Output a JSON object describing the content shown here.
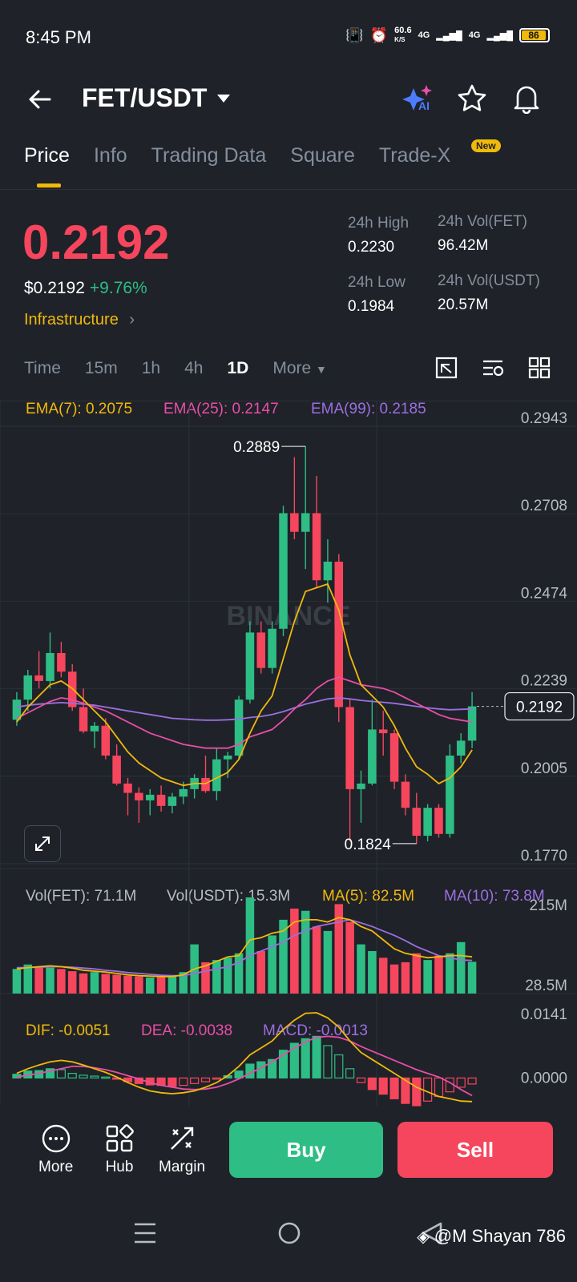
{
  "status_bar": {
    "time": "8:45 PM",
    "net_speed": "60.6",
    "net_unit": "K/S",
    "signal1": "4G",
    "signal2": "4G",
    "battery": "86"
  },
  "header": {
    "pair": "FET/USDT",
    "ai_label": "AI"
  },
  "tabs": [
    {
      "label": "Price",
      "active": true
    },
    {
      "label": "Info"
    },
    {
      "label": "Trading Data"
    },
    {
      "label": "Square"
    },
    {
      "label": "Trade-X",
      "badge": "New"
    }
  ],
  "ticker": {
    "last_price": "0.2192",
    "usd_price": "$0.2192",
    "change_pct": "+9.76%",
    "category": "Infrastructure",
    "high_label": "24h High",
    "high": "0.2230",
    "low_label": "24h Low",
    "low": "0.1984",
    "vol_base_label": "24h Vol(FET)",
    "vol_base": "96.42M",
    "vol_quote_label": "24h Vol(USDT)",
    "vol_quote": "20.57M"
  },
  "intervals": [
    {
      "label": "Time"
    },
    {
      "label": "15m"
    },
    {
      "label": "1h"
    },
    {
      "label": "4h"
    },
    {
      "label": "1D",
      "active": true
    },
    {
      "label": "More"
    }
  ],
  "indicators": {
    "ema7": "EMA(7): 0.2075",
    "ema25": "EMA(25): 0.2147",
    "ema99": "EMA(99): 0.2185",
    "vol_base": "Vol(FET): 71.1M",
    "vol_quote": "Vol(USDT): 15.3M",
    "ma5": "MA(5): 82.5M",
    "ma10": "MA(10): 73.8M",
    "dif": "DIF: -0.0051",
    "dea": "DEA: -0.0038",
    "macd": "MACD: -0.0013"
  },
  "colors": {
    "up": "#2ebd85",
    "down": "#f6465d",
    "ema7": "#f0b90b",
    "ema25": "#e84ea7",
    "ema99": "#9b6fe0",
    "accent": "#f0b90b"
  },
  "chart_data": {
    "type": "candlestick",
    "price_axis": [
      "0.2943",
      "0.2708",
      "0.2474",
      "0.2239",
      "0.2005",
      "0.1770"
    ],
    "current_price_tag": "0.2192",
    "high_marker": "0.2889",
    "low_marker": "0.1824",
    "watermark": "BINANCE",
    "volume_axis": [
      "215M",
      "28.5M"
    ],
    "macd_axis": [
      "0.0141",
      "0.0000"
    ],
    "ylim": [
      0.177,
      0.2943
    ],
    "candles": [
      [
        0.2156,
        0.223,
        0.214,
        0.221
      ],
      [
        0.221,
        0.229,
        0.218,
        0.2275
      ],
      [
        0.2275,
        0.234,
        0.224,
        0.226
      ],
      [
        0.226,
        0.239,
        0.224,
        0.2335
      ],
      [
        0.2335,
        0.2365,
        0.227,
        0.2285
      ],
      [
        0.2285,
        0.2305,
        0.218,
        0.219
      ],
      [
        0.219,
        0.224,
        0.212,
        0.2125
      ],
      [
        0.2125,
        0.215,
        0.208,
        0.214
      ],
      [
        0.214,
        0.216,
        0.205,
        0.206
      ],
      [
        0.206,
        0.209,
        0.198,
        0.1985
      ],
      [
        0.1985,
        0.2,
        0.19,
        0.196
      ],
      [
        0.196,
        0.1975,
        0.188,
        0.194
      ],
      [
        0.194,
        0.197,
        0.19,
        0.1955
      ],
      [
        0.1955,
        0.198,
        0.191,
        0.1925
      ],
      [
        0.1925,
        0.196,
        0.1905,
        0.195
      ],
      [
        0.195,
        0.199,
        0.193,
        0.197
      ],
      [
        0.197,
        0.201,
        0.1945,
        0.2
      ],
      [
        0.2,
        0.206,
        0.196,
        0.1965
      ],
      [
        0.1965,
        0.208,
        0.194,
        0.205
      ],
      [
        0.205,
        0.207,
        0.2,
        0.206
      ],
      [
        0.206,
        0.222,
        0.205,
        0.221
      ],
      [
        0.221,
        0.242,
        0.22,
        0.239
      ],
      [
        0.239,
        0.242,
        0.228,
        0.2295
      ],
      [
        0.2295,
        0.242,
        0.228,
        0.24
      ],
      [
        0.24,
        0.273,
        0.238,
        0.271
      ],
      [
        0.271,
        0.286,
        0.264,
        0.266
      ],
      [
        0.266,
        0.2889,
        0.256,
        0.271
      ],
      [
        0.271,
        0.281,
        0.251,
        0.253
      ],
      [
        0.253,
        0.264,
        0.247,
        0.258
      ],
      [
        0.258,
        0.26,
        0.215,
        0.219
      ],
      [
        0.219,
        0.221,
        0.183,
        0.197
      ],
      [
        0.197,
        0.202,
        0.188,
        0.1985
      ],
      [
        0.1985,
        0.221,
        0.198,
        0.213
      ],
      [
        0.213,
        0.218,
        0.206,
        0.212
      ],
      [
        0.212,
        0.213,
        0.197,
        0.199
      ],
      [
        0.199,
        0.201,
        0.19,
        0.192
      ],
      [
        0.192,
        0.196,
        0.1824,
        0.1845
      ],
      [
        0.1845,
        0.193,
        0.183,
        0.192
      ],
      [
        0.192,
        0.193,
        0.184,
        0.185
      ],
      [
        0.185,
        0.209,
        0.184,
        0.206
      ],
      [
        0.206,
        0.212,
        0.204,
        0.21
      ],
      [
        0.21,
        0.223,
        0.208,
        0.2192
      ]
    ],
    "ema7": [
      0.215,
      0.219,
      0.222,
      0.225,
      0.226,
      0.224,
      0.221,
      0.218,
      0.215,
      0.211,
      0.207,
      0.204,
      0.202,
      0.2,
      0.199,
      0.198,
      0.1985,
      0.1985,
      0.2,
      0.2015,
      0.205,
      0.212,
      0.218,
      0.222,
      0.232,
      0.242,
      0.25,
      0.251,
      0.252,
      0.245,
      0.233,
      0.225,
      0.222,
      0.219,
      0.214,
      0.208,
      0.203,
      0.201,
      0.1985,
      0.2,
      0.203,
      0.2075
    ],
    "ema25": [
      0.216,
      0.2175,
      0.219,
      0.2205,
      0.2215,
      0.221,
      0.22,
      0.219,
      0.218,
      0.2165,
      0.215,
      0.2135,
      0.212,
      0.211,
      0.21,
      0.209,
      0.2085,
      0.208,
      0.208,
      0.208,
      0.209,
      0.211,
      0.212,
      0.213,
      0.2155,
      0.2185,
      0.221,
      0.224,
      0.226,
      0.227,
      0.226,
      0.225,
      0.2245,
      0.224,
      0.223,
      0.2215,
      0.22,
      0.2185,
      0.217,
      0.216,
      0.2155,
      0.215
    ],
    "ema99": [
      0.219,
      0.2195,
      0.2198,
      0.22,
      0.2202,
      0.22,
      0.2198,
      0.2195,
      0.219,
      0.2185,
      0.218,
      0.2175,
      0.217,
      0.2165,
      0.216,
      0.2158,
      0.2156,
      0.2155,
      0.2155,
      0.2156,
      0.2158,
      0.2162,
      0.2165,
      0.217,
      0.2178,
      0.2188,
      0.2198,
      0.2205,
      0.2212,
      0.2215,
      0.2212,
      0.2208,
      0.2205,
      0.2203,
      0.22,
      0.2196,
      0.2192,
      0.2188,
      0.2185,
      0.2183,
      0.2184,
      0.2185
    ],
    "volume": [
      55,
      65,
      60,
      58,
      55,
      50,
      45,
      48,
      44,
      42,
      40,
      38,
      36,
      38,
      40,
      48,
      110,
      70,
      75,
      80,
      90,
      215,
      95,
      130,
      165,
      190,
      185,
      150,
      140,
      200,
      160,
      110,
      95,
      80,
      65,
      70,
      90,
      75,
      85,
      90,
      115,
      71
    ],
    "volume_max": 215,
    "ma5": [
      55,
      58,
      60,
      62,
      60,
      57,
      52,
      50,
      48,
      45,
      42,
      40,
      39,
      38,
      38,
      42,
      55,
      62,
      72,
      82,
      85,
      120,
      125,
      135,
      140,
      160,
      165,
      165,
      160,
      170,
      165,
      150,
      140,
      120,
      100,
      90,
      85,
      80,
      82,
      85,
      85,
      82
    ],
    "ma10": [
      58,
      58,
      59,
      60,
      60,
      59,
      57,
      55,
      52,
      50,
      47,
      45,
      43,
      41,
      40,
      40,
      45,
      50,
      55,
      60,
      70,
      85,
      95,
      105,
      115,
      130,
      140,
      150,
      155,
      160,
      165,
      158,
      150,
      140,
      130,
      118,
      105,
      95,
      85,
      80,
      75,
      74
    ],
    "macd_hist": [
      0.0008,
      0.0015,
      0.0016,
      0.002,
      0.0018,
      0.001,
      0.0006,
      0.0004,
      0.0002,
      -0.0002,
      -0.0008,
      -0.0012,
      -0.0015,
      -0.0016,
      -0.0018,
      -0.0016,
      -0.0012,
      -0.0008,
      -0.0002,
      0.0005,
      0.0015,
      0.003,
      0.0035,
      0.004,
      0.006,
      0.0075,
      0.0085,
      0.009,
      0.007,
      0.005,
      0.002,
      -0.001,
      -0.0025,
      -0.0035,
      -0.0045,
      -0.0055,
      -0.006,
      -0.005,
      -0.004,
      -0.003,
      -0.002,
      -0.0013
    ],
    "dif": [
      0.001,
      0.002,
      0.0028,
      0.0035,
      0.0038,
      0.0035,
      0.0028,
      0.002,
      0.0012,
      0.0002,
      -0.001,
      -0.002,
      -0.0028,
      -0.0032,
      -0.0034,
      -0.0032,
      -0.0028,
      -0.002,
      -0.001,
      0.0005,
      0.0025,
      0.005,
      0.0065,
      0.008,
      0.0105,
      0.0125,
      0.014,
      0.0141,
      0.013,
      0.011,
      0.008,
      0.0055,
      0.004,
      0.0025,
      0.001,
      -0.0005,
      -0.002,
      -0.003,
      -0.004,
      -0.0045,
      -0.005,
      -0.0051
    ],
    "dea": [
      0.0002,
      0.0006,
      0.001,
      0.0015,
      0.002,
      0.0025,
      0.0025,
      0.0022,
      0.0018,
      0.0012,
      0.0005,
      -0.0002,
      -0.001,
      -0.0016,
      -0.002,
      -0.0024,
      -0.0025,
      -0.0024,
      -0.002,
      -0.0012,
      -0.0002,
      0.001,
      0.0022,
      0.0035,
      0.005,
      0.0065,
      0.0078,
      0.0088,
      0.009,
      0.0088,
      0.008,
      0.0068,
      0.0058,
      0.0048,
      0.0038,
      0.0028,
      0.0018,
      0.001,
      0.0002,
      -0.001,
      -0.0025,
      -0.0038
    ],
    "macd_ylim": [
      -0.006,
      0.0141
    ]
  },
  "bottom_bar": {
    "more": "More",
    "hub": "Hub",
    "margin": "Margin",
    "buy": "Buy",
    "sell": "Sell"
  },
  "watermark_text": "@M Shayan 786"
}
